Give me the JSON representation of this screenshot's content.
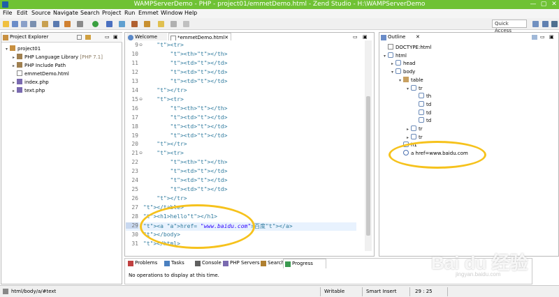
{
  "window": {
    "title": "WAMPServerDemo - PHP - project01/emmetDemo.html - Zend Studio - H:\\WAMPServerDemo",
    "minimize": "—",
    "maximize": "▢",
    "close": "✕"
  },
  "menu": [
    "File",
    "Edit",
    "Source",
    "Navigate",
    "Search",
    "Project",
    "Run",
    "Emmet",
    "Window",
    "Help"
  ],
  "toolbar": {
    "quick_access_placeholder": "Quick Access"
  },
  "project_explorer": {
    "tab_label": "Project Explorer",
    "items": [
      {
        "label": "project01",
        "level": 0,
        "arrow": "▾",
        "icon": "project-folder-icon"
      },
      {
        "label": "PHP Language Library",
        "suffix": " [PHP 7.1]",
        "level": 1,
        "arrow": "▸",
        "icon": "library-icon"
      },
      {
        "label": "PHP Include Path",
        "level": 1,
        "arrow": "▸",
        "icon": "library-icon"
      },
      {
        "label": "emmetDemo.html",
        "level": 1,
        "arrow": "",
        "icon": "html-file-icon"
      },
      {
        "label": "index.php",
        "level": 1,
        "arrow": "▸",
        "icon": "php-file-icon"
      },
      {
        "label": "text.php",
        "level": 1,
        "arrow": "▸",
        "icon": "php-file-icon"
      }
    ]
  },
  "editor": {
    "tabs": [
      {
        "label": "Welcome",
        "active": false
      },
      {
        "label": "*emmetDemo.html",
        "active": true
      }
    ],
    "lines": [
      {
        "n": "9",
        "fold": "⊖",
        "code": "    <tr>"
      },
      {
        "n": "10",
        "fold": "",
        "code": "        <th></th>"
      },
      {
        "n": "11",
        "fold": "",
        "code": "        <td></td>"
      },
      {
        "n": "12",
        "fold": "",
        "code": "        <td></td>"
      },
      {
        "n": "13",
        "fold": "",
        "code": "        <td></td>"
      },
      {
        "n": "14",
        "fold": "",
        "code": "    </tr>"
      },
      {
        "n": "15",
        "fold": "⊖",
        "code": "    <tr>"
      },
      {
        "n": "16",
        "fold": "",
        "code": "        <th></th>"
      },
      {
        "n": "17",
        "fold": "",
        "code": "        <td></td>"
      },
      {
        "n": "18",
        "fold": "",
        "code": "        <td></td>"
      },
      {
        "n": "19",
        "fold": "",
        "code": "        <td></td>"
      },
      {
        "n": "20",
        "fold": "",
        "code": "    </tr>"
      },
      {
        "n": "21",
        "fold": "⊖",
        "code": "    <tr>"
      },
      {
        "n": "22",
        "fold": "",
        "code": "        <th></th>"
      },
      {
        "n": "23",
        "fold": "",
        "code": "        <td></td>"
      },
      {
        "n": "24",
        "fold": "",
        "code": "        <td></td>"
      },
      {
        "n": "25",
        "fold": "",
        "code": "        <td></td>"
      },
      {
        "n": "26",
        "fold": "",
        "code": "    </tr>"
      },
      {
        "n": "27",
        "fold": "",
        "code": "</table>"
      },
      {
        "n": "28",
        "fold": "",
        "code": "<h1>hello</h1>"
      },
      {
        "n": "29",
        "fold": "",
        "code": "<a href= \"www.baidu.com\">百度</a>"
      },
      {
        "n": "30",
        "fold": "",
        "code": "</body>"
      },
      {
        "n": "31",
        "fold": "",
        "code": "</html>"
      }
    ],
    "current_line": "29"
  },
  "outline": {
    "tab_label": "Outline",
    "items": [
      {
        "label": "DOCTYPE:html",
        "level": 0,
        "arrow": "",
        "icon": "doctype-icon"
      },
      {
        "label": "html",
        "level": 0,
        "arrow": "▾",
        "icon": "element-icon"
      },
      {
        "label": "head",
        "level": 1,
        "arrow": "▸",
        "icon": "element-icon"
      },
      {
        "label": "body",
        "level": 1,
        "arrow": "▾",
        "icon": "element-icon"
      },
      {
        "label": "table",
        "level": 2,
        "arrow": "▾",
        "icon": "table-icon"
      },
      {
        "label": "tr",
        "level": 3,
        "arrow": "▾",
        "icon": "element-icon"
      },
      {
        "label": "th",
        "level": 4,
        "arrow": "",
        "icon": "element-icon"
      },
      {
        "label": "td",
        "level": 4,
        "arrow": "",
        "icon": "element-icon"
      },
      {
        "label": "td",
        "level": 4,
        "arrow": "",
        "icon": "element-icon"
      },
      {
        "label": "td",
        "level": 4,
        "arrow": "",
        "icon": "element-icon"
      },
      {
        "label": "tr",
        "level": 3,
        "arrow": "▸",
        "icon": "element-icon"
      },
      {
        "label": "tr",
        "level": 3,
        "arrow": "▸",
        "icon": "element-icon"
      },
      {
        "label": "h1",
        "level": 2,
        "arrow": "",
        "icon": "element-icon"
      },
      {
        "label": "a href=www.baidu.com",
        "level": 2,
        "arrow": "",
        "icon": "anchor-icon"
      }
    ]
  },
  "bottom_panel": {
    "tabs": [
      "Problems",
      "Tasks",
      "Console",
      "PHP Servers",
      "Search",
      "Progress"
    ],
    "active_tab": "Progress",
    "message": "No operations to display at this time."
  },
  "status_bar": {
    "path": "html/body/a/#text",
    "mode": "Writable",
    "insert": "Smart Insert",
    "position": "29 : 25"
  },
  "watermark": {
    "brand": "Bai du 经验",
    "url": "jingyan.baidu.com"
  },
  "colors": {
    "title_bar": "#6fc234",
    "highlight_ring": "#f6c21c",
    "tag": "#2e7a9e",
    "attr_value": "#2a00ff"
  }
}
